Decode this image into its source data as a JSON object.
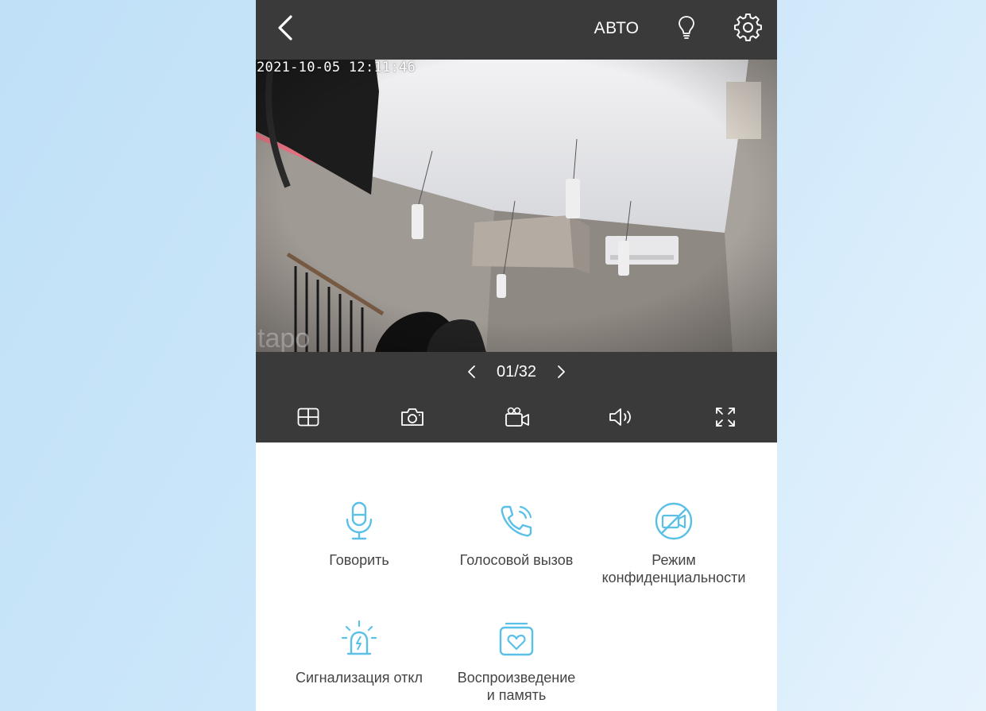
{
  "colors": {
    "bar": "#3a3a3a",
    "accent": "#5bc0e8",
    "label": "#444444"
  },
  "header": {
    "back_icon": "chevron-left-icon",
    "mode_label": "АВТО",
    "light_icon": "lightbulb-icon",
    "settings_icon": "gear-icon"
  },
  "video": {
    "timestamp": "2021-10-05 12:11:46",
    "watermark": "tapo"
  },
  "pager": {
    "count": "01/32"
  },
  "controls": [
    {
      "icon": "grid-view-icon"
    },
    {
      "icon": "camera-snapshot-icon"
    },
    {
      "icon": "video-record-icon"
    },
    {
      "icon": "speaker-icon"
    },
    {
      "icon": "fullscreen-icon"
    }
  ],
  "features": [
    {
      "label": "Говорить",
      "icon": "microphone-icon"
    },
    {
      "label": "Голосовой вызов",
      "icon": "phone-call-icon"
    },
    {
      "label": "Режим\nконфиденциальности",
      "icon": "privacy-mode-icon"
    },
    {
      "label": "Сигнализация откл",
      "icon": "alarm-siren-icon"
    },
    {
      "label": "Воспроизведение\nи память",
      "icon": "playback-memory-icon"
    }
  ]
}
